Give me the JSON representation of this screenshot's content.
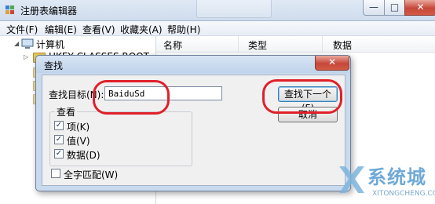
{
  "window": {
    "title": "注册表编辑器",
    "minimize_glyph": "—",
    "maximize_glyph": "□",
    "close_glyph": "✕"
  },
  "menubar": {
    "items": [
      "文件(F)",
      "编辑(E)",
      "查看(V)",
      "收藏夹(A)",
      "帮助(H)"
    ]
  },
  "tree": {
    "root_label": "计算机",
    "root_expander": "◢",
    "items": [
      {
        "label": "HKEY CLASSES ROOT",
        "expander": "▷"
      }
    ]
  },
  "list": {
    "columns": [
      "名称",
      "类型",
      "数据"
    ]
  },
  "find_dialog": {
    "title": "查找",
    "close_glyph": "✕",
    "find_target_label": "查找目标(N):",
    "find_target_value": "BaiduSd",
    "find_next_button": "查找下一个(F)",
    "cancel_button": "取消",
    "look_at_group": "查看",
    "checkboxes": [
      {
        "label": "项(K)",
        "checked": true
      },
      {
        "label": "值(V)",
        "checked": true
      },
      {
        "label": "数据(D)",
        "checked": true
      }
    ],
    "match_whole": {
      "label": "全字匹配(W)",
      "checked": false
    },
    "check_glyph": "✓"
  },
  "watermark": {
    "text": "系统城",
    "subtext": "XITONGCHENG.COM"
  },
  "colors": {
    "annotation": "#e0202a",
    "dialog_frame": "#c9daee",
    "close_button": "#c7473a"
  }
}
